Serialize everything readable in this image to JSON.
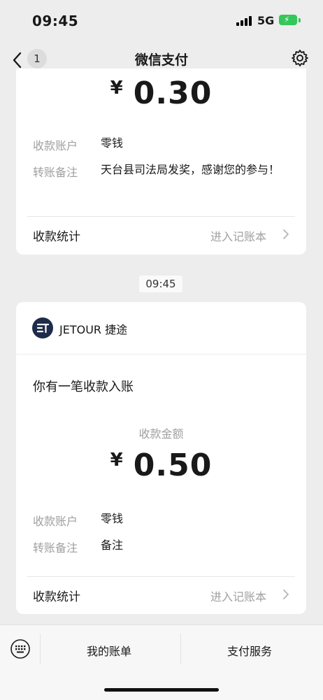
{
  "status": {
    "time": "09:45",
    "network": "5G"
  },
  "nav": {
    "back_count": "1",
    "title": "微信支付"
  },
  "card1": {
    "currency": "¥",
    "amount": "0.30",
    "account_label": "收款账户",
    "account_value": "零钱",
    "note_label": "转账备注",
    "note_value": "天台县司法局发奖，感谢您的参与！",
    "stats_label": "收款统计",
    "stats_link": "进入记账本"
  },
  "timestamp": "09:45",
  "card2": {
    "brand_name": "JETOUR 捷途",
    "notice": "你有一笔收款入账",
    "amount_caption": "收款金额",
    "currency": "¥",
    "amount": "0.50",
    "account_label": "收款账户",
    "account_value": "零钱",
    "note_label": "转账备注",
    "note_value": "备注",
    "stats_label": "收款统计",
    "stats_link": "进入记账本"
  },
  "menu": {
    "item1": "我的账单",
    "item2": "支付服务"
  },
  "colors": {
    "background": "#ededed",
    "card": "#ffffff",
    "muted": "#a0a0a0",
    "battery": "#34c759",
    "brand": "#1d2c4a"
  }
}
